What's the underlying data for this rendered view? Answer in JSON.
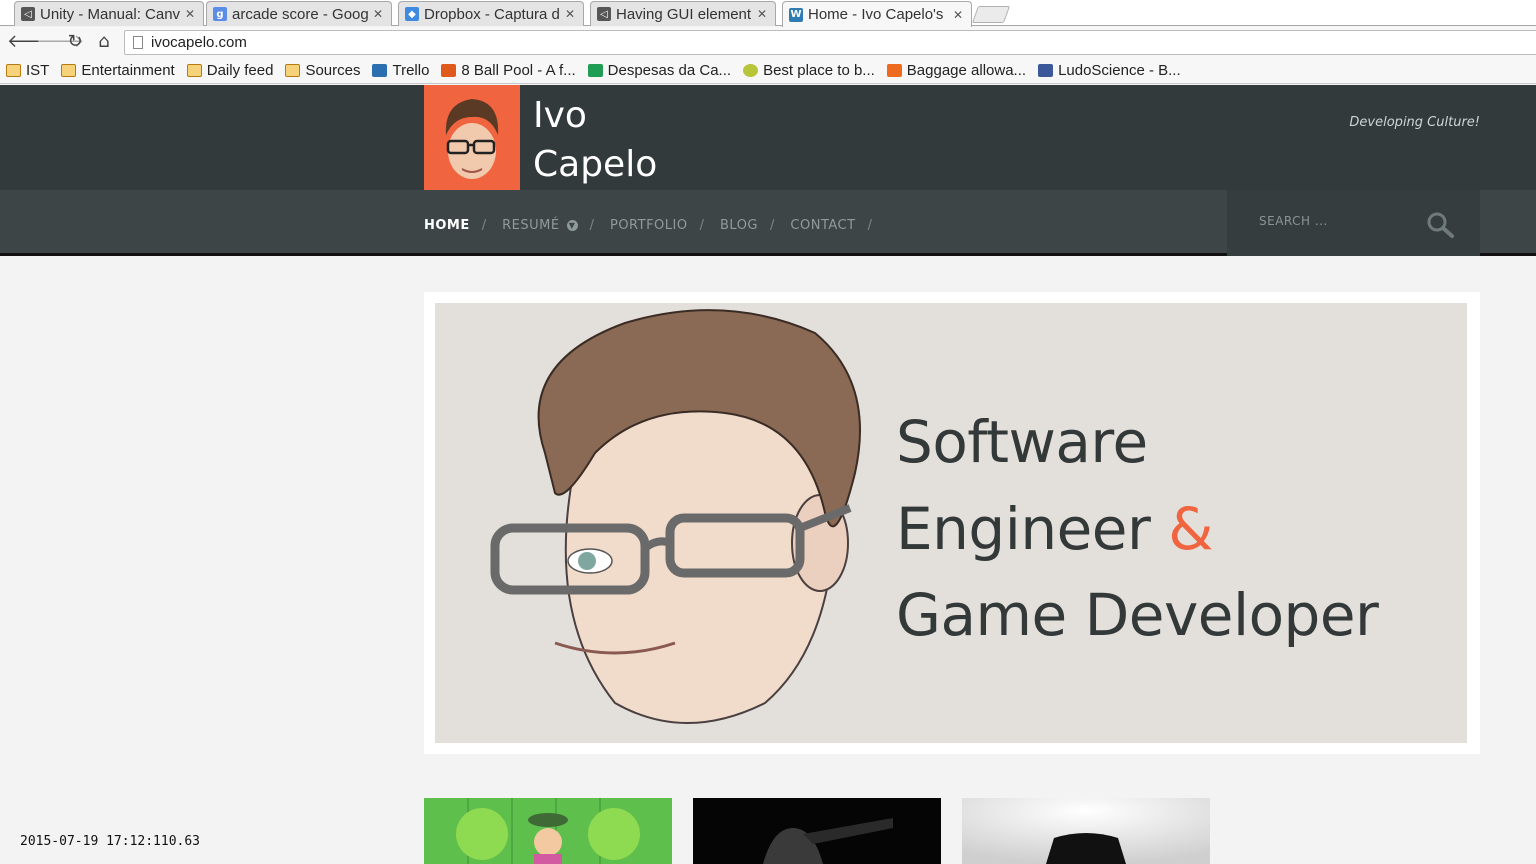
{
  "browser": {
    "tabs": [
      {
        "title": "Unity - Manual: Canv",
        "icon": "unity-icon",
        "active": false
      },
      {
        "title": "arcade score - Googl",
        "icon": "google-icon",
        "active": false
      },
      {
        "title": "Dropbox - Captura d",
        "icon": "dropbox-icon",
        "active": false
      },
      {
        "title": "Having GUI element",
        "icon": "unity-icon",
        "active": false
      },
      {
        "title": "Home - Ivo Capelo's",
        "icon": "wordpress-icon",
        "active": true
      }
    ],
    "url": "ivocapelo.com",
    "bookmarks": [
      {
        "label": "IST",
        "icon": "folder-icon"
      },
      {
        "label": "Entertainment",
        "icon": "folder-icon"
      },
      {
        "label": "Daily feed",
        "icon": "folder-icon"
      },
      {
        "label": "Sources",
        "icon": "folder-icon"
      },
      {
        "label": "Trello",
        "icon": "trello-icon"
      },
      {
        "label": "8 Ball Pool - A f...",
        "icon": "play-icon"
      },
      {
        "label": "Despesas da Ca...",
        "icon": "sheets-icon"
      },
      {
        "label": "Best place to b...",
        "icon": "smiley-icon"
      },
      {
        "label": "Baggage allowa...",
        "icon": "e-icon"
      },
      {
        "label": "LudoScience - B...",
        "icon": "facebook-icon"
      }
    ]
  },
  "site": {
    "name_line1": "Ivo",
    "name_line2": "Capelo",
    "tagline": "Developing Culture!",
    "accent": "#f0653f",
    "header_bg": "#333a3c",
    "nav_bg": "#3d4547",
    "nav": [
      {
        "label": "HOME",
        "current": true,
        "dropdown": false
      },
      {
        "label": "RESUMÉ",
        "current": false,
        "dropdown": true
      },
      {
        "label": "PORTFOLIO",
        "current": false,
        "dropdown": false
      },
      {
        "label": "BLOG",
        "current": false,
        "dropdown": false
      },
      {
        "label": "CONTACT",
        "current": false,
        "dropdown": false
      }
    ],
    "nav_separator": "/",
    "search_placeholder": "SEARCH ..."
  },
  "hero": {
    "line1": "Software",
    "line2": "Engineer",
    "ampersand": "&",
    "line3": "Game Developer"
  },
  "overlay": {
    "timestamp": "2015-07-19 17:12:110.63"
  }
}
